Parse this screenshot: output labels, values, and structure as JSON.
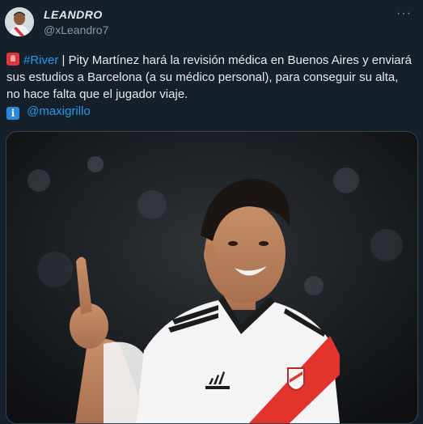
{
  "author": {
    "display_name": "LEANDRO",
    "handle": "@xLeandro7"
  },
  "tweet": {
    "hashtag": "#River",
    "text_part1": " | Pity Martínez hará la revisión médica en Buenos Aires y enviará sus estudios a Barcelona (a su médico personal), para conseguir su alta, no hace falta que el jugador viaje.",
    "mention": "@maxigrillo"
  },
  "menu": {
    "more_label": "···"
  },
  "colors": {
    "background": "#15202b",
    "link": "#1d9bf0",
    "muted": "#8b98a5",
    "jersey_stripe": "#e2342d"
  },
  "icons": {
    "siren": "siren-emoji-icon",
    "info": "info-emoji-icon",
    "more": "more-options-icon"
  }
}
